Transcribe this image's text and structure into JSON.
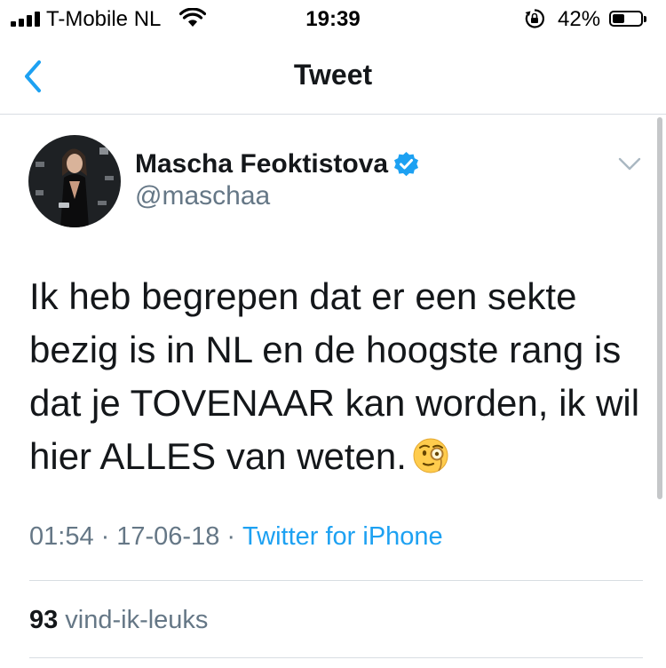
{
  "status_bar": {
    "carrier": "T-Mobile NL",
    "time": "19:39",
    "battery_percent": "42%",
    "battery_level": 0.42,
    "icons": [
      "signal-icon",
      "wifi-icon",
      "rotation-lock-icon",
      "battery-icon"
    ]
  },
  "nav": {
    "title": "Tweet",
    "back_icon": "chevron-left-icon",
    "accent_color": "#1da1f2"
  },
  "tweet": {
    "author": {
      "display_name": "Mascha Feoktistova",
      "handle": "@maschaa",
      "verified": true
    },
    "text_lines": [
      "Ik heb begrepen dat er een sekte",
      "bezig is in NL en de hoogste rang is",
      "dat je TOVENAAR kan worden, ik wil",
      "hier ALLES van weten."
    ],
    "emoji": "face-with-monocle-icon",
    "time": "01:54",
    "date": "17-06-18",
    "source": "Twitter for iPhone",
    "likes_count": "93",
    "likes_label": "vind-ik-leuks"
  }
}
